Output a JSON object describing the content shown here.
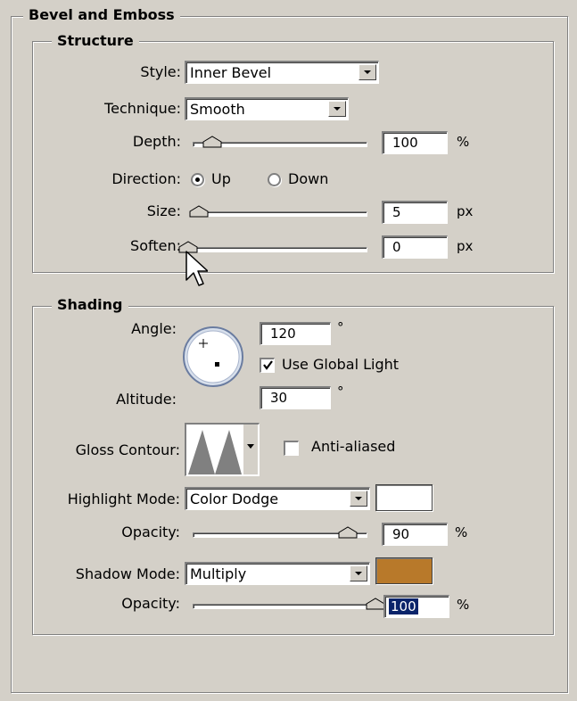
{
  "panel": {
    "title": "Bevel and Emboss"
  },
  "structure": {
    "title": "Structure",
    "style_label": "Style:",
    "style_value": "Inner Bevel",
    "technique_label": "Technique:",
    "technique_value": "Smooth",
    "depth_label": "Depth:",
    "depth_value": "100",
    "depth_unit": "%",
    "depth_slider_fraction": 0.1,
    "direction_label": "Direction:",
    "direction_up": "Up",
    "direction_down": "Down",
    "direction_selected": "Up",
    "size_label": "Size:",
    "size_value": "5",
    "size_unit": "px",
    "size_slider_fraction": 0.02,
    "soften_label": "Soften:",
    "soften_value": "0",
    "soften_unit": "px",
    "soften_slider_fraction": 0.0
  },
  "shading": {
    "title": "Shading",
    "angle_label": "Angle:",
    "angle_value": "120",
    "angle_unit": "°",
    "use_global_light_label": "Use Global Light",
    "use_global_light_checked": true,
    "altitude_label": "Altitude:",
    "altitude_value": "30",
    "altitude_unit": "°",
    "gloss_contour_label": "Gloss Contour:",
    "anti_aliased_label": "Anti-aliased",
    "anti_aliased_checked": false,
    "highlight_mode_label": "Highlight Mode:",
    "highlight_mode_value": "Color Dodge",
    "highlight_color": "#ffffff",
    "highlight_opacity_label": "Opacity:",
    "highlight_opacity_value": "90",
    "highlight_opacity_unit": "%",
    "highlight_opacity_fraction": 0.9,
    "shadow_mode_label": "Shadow Mode:",
    "shadow_mode_value": "Multiply",
    "shadow_color": "#b8792a",
    "shadow_opacity_label": "Opacity:",
    "shadow_opacity_value": "100",
    "shadow_opacity_unit": "%",
    "shadow_opacity_fraction": 1.0
  },
  "cursor": {
    "icon": "arrow-cursor-icon"
  }
}
